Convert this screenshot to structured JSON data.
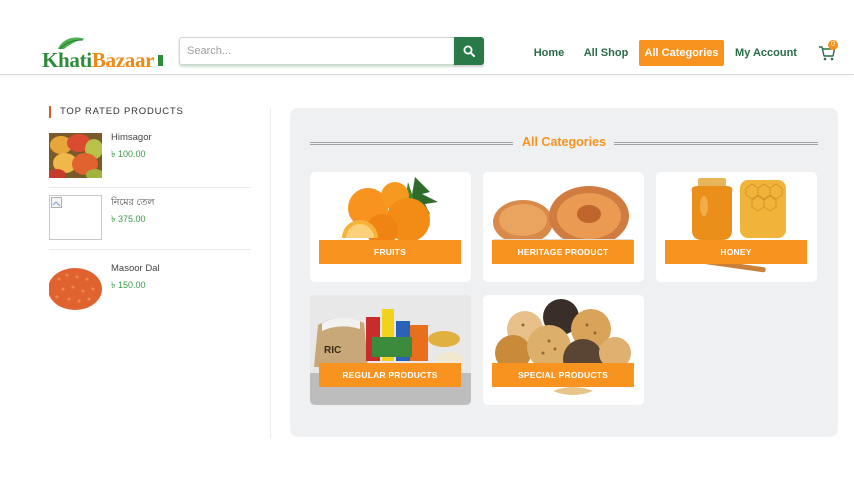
{
  "brand": {
    "logo_part1": "Khati",
    "logo_part2": "Bazaar"
  },
  "search": {
    "placeholder": "Search..."
  },
  "nav": {
    "items": [
      {
        "label": "Home"
      },
      {
        "label": "All Shop"
      },
      {
        "label": "All Categories",
        "active": true
      },
      {
        "label": "My Account"
      }
    ],
    "cart_count": "0"
  },
  "sidebar": {
    "title": "TOP RATED PRODUCTS",
    "products": [
      {
        "name": "Himsagor",
        "price": "৳ 100.00"
      },
      {
        "name": "নিমের তেল",
        "price": "৳ 375.00"
      },
      {
        "name": "Masoor Dal",
        "price": "৳ 150.00"
      }
    ]
  },
  "main": {
    "title": "All Categories",
    "categories": [
      {
        "label": "FRUITS"
      },
      {
        "label": "HERITAGE PRODUCT"
      },
      {
        "label": "HONEY"
      },
      {
        "label": "REGULAR PRODUCTS"
      },
      {
        "label": "SPECIAL PRODUCTS"
      }
    ]
  },
  "colors": {
    "accent": "#f7931e",
    "brand_green": "#2e8b3a",
    "nav_text": "#2a6b47",
    "search_button": "#2a7a49",
    "panel": "#eef0f2"
  }
}
